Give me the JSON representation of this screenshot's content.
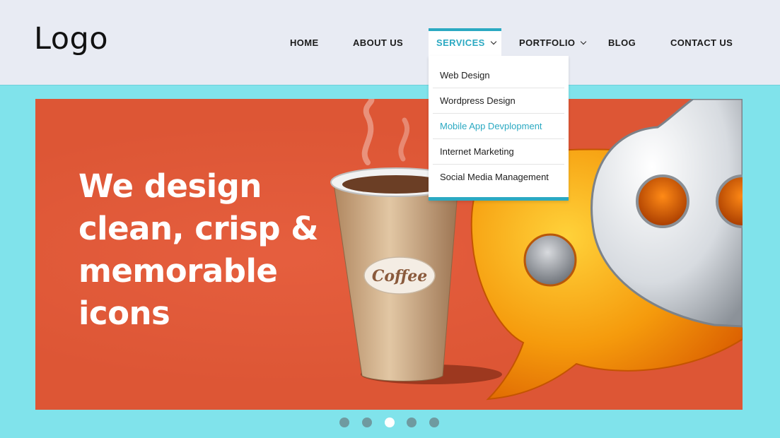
{
  "header": {
    "logo": "Logo"
  },
  "nav": {
    "items": [
      {
        "label": "HOME"
      },
      {
        "label": "ABOUT US"
      },
      {
        "label": "SERVICES"
      },
      {
        "label": "PORTFOLIO"
      },
      {
        "label": "BLOG"
      },
      {
        "label": "CONTACT US"
      }
    ],
    "active_index": 2
  },
  "dropdown": {
    "items": [
      {
        "label": "Web Design"
      },
      {
        "label": "Wordpress Design"
      },
      {
        "label": "Mobile App Devplopment"
      },
      {
        "label": "Internet Marketing"
      },
      {
        "label": "Social Media Management"
      }
    ],
    "highlighted_index": 2
  },
  "slider": {
    "headline": [
      "We design",
      "clean, crisp &",
      "memorable",
      "icons"
    ],
    "cup_label": "Coffee",
    "dot_count": 5,
    "active_dot": 2
  },
  "colors": {
    "accent": "#2ba9c2",
    "page_bg": "#80e3eb",
    "header_bg": "#e8ebf3",
    "slide_bg": "#dd5635"
  }
}
